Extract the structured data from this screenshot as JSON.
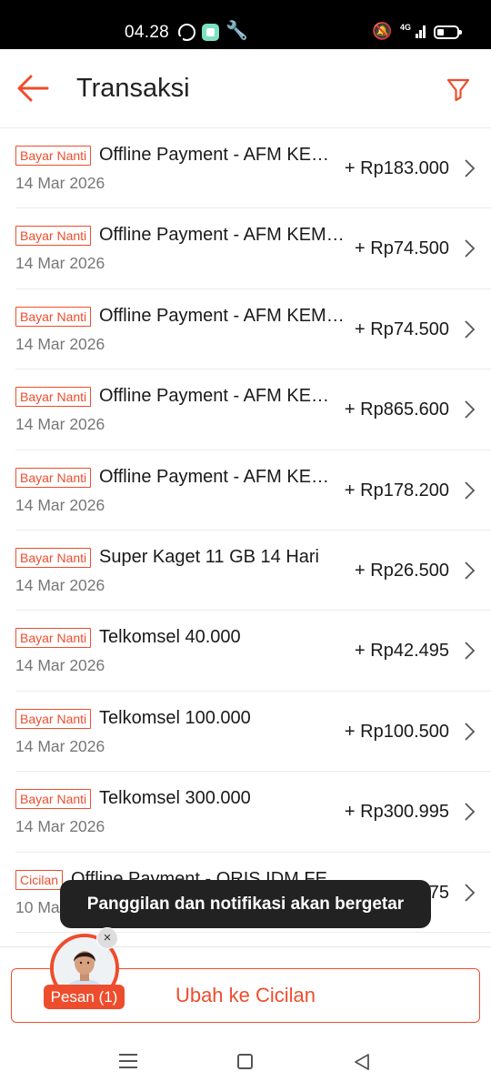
{
  "status_bar": {
    "time": "04.28",
    "network": "4G",
    "icons": [
      "whatsapp-icon",
      "app-icon",
      "wrench-icon",
      "mute-vibrate-icon",
      "signal-icon",
      "battery-icon"
    ]
  },
  "header": {
    "title": "Transaksi",
    "back_icon": "arrow-left-icon",
    "filter_icon": "filter-icon"
  },
  "transactions": [
    {
      "badge": "Bayar Nanti",
      "title": "Offline Payment - AFM KEMBANGAN",
      "date": "14 Mar 2026",
      "amount": "+ Rp183.000"
    },
    {
      "badge": "Bayar Nanti",
      "title": "Offline Payment - AFM KEMBANGAN",
      "date": "14 Mar 2026",
      "amount": "+ Rp74.500"
    },
    {
      "badge": "Bayar Nanti",
      "title": "Offline Payment - AFM KEMBANGAN",
      "date": "14 Mar 2026",
      "amount": "+ Rp74.500"
    },
    {
      "badge": "Bayar Nanti",
      "title": "Offline Payment - AFM KEMBANGAN",
      "date": "14 Mar 2026",
      "amount": "+ Rp865.600"
    },
    {
      "badge": "Bayar Nanti",
      "title": "Offline Payment - AFM KEMBANGAN",
      "date": "14 Mar 2026",
      "amount": "+ Rp178.200"
    },
    {
      "badge": "Bayar Nanti",
      "title": "Super Kaget 11 GB 14 Hari",
      "date": "14 Mar 2026",
      "amount": "+ Rp26.500"
    },
    {
      "badge": "Bayar Nanti",
      "title": "Telkomsel 40.000",
      "date": "14 Mar 2026",
      "amount": "+ Rp42.495"
    },
    {
      "badge": "Bayar Nanti",
      "title": "Telkomsel 100.000",
      "date": "14 Mar 2026",
      "amount": "+ Rp100.500"
    },
    {
      "badge": "Bayar Nanti",
      "title": "Telkomsel 300.000",
      "date": "14 Mar 2026",
      "amount": "+ Rp300.995"
    },
    {
      "badge": "Cicilan",
      "title": "Offline Payment - QRIS IDM FE",
      "date": "10 Ma",
      "amount": "75"
    }
  ],
  "toast": {
    "text": "Panggilan dan notifikasi akan bergetar"
  },
  "chat_bubble": {
    "label": "Pesan (1)",
    "close_icon": "close-icon",
    "close_glyph": "×",
    "avatar": "agent-avatar"
  },
  "bottom": {
    "button_label": "Ubah ke Cicilan"
  },
  "colors": {
    "accent": "#ee4d2d",
    "text": "#1a1a1a",
    "muted": "#777777",
    "toast": "#222222"
  },
  "nav_bar": {
    "icons": [
      "recent-apps-icon",
      "home-icon",
      "back-icon"
    ]
  }
}
